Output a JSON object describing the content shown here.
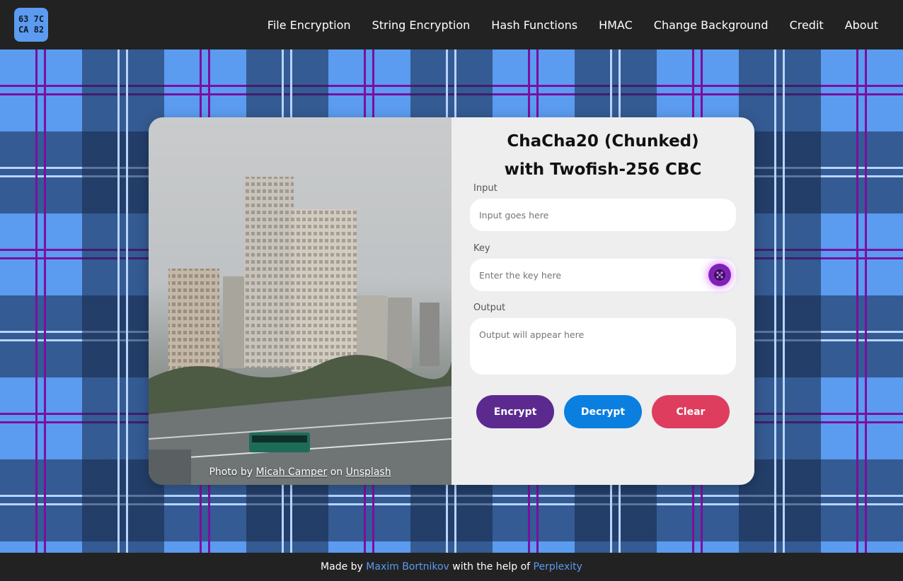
{
  "header": {
    "logo": {
      "line1": "63 7C",
      "line2": "CA 82"
    },
    "nav": [
      {
        "label": "File Encryption"
      },
      {
        "label": "String Encryption"
      },
      {
        "label": "Hash Functions"
      },
      {
        "label": "HMAC"
      },
      {
        "label": "Change Background"
      },
      {
        "label": "Credit"
      },
      {
        "label": "About"
      }
    ]
  },
  "card": {
    "photo_credit": {
      "prefix": "Photo by ",
      "author": "Micah Camper",
      "middle": " on ",
      "source": "Unsplash"
    },
    "title_line1": "ChaCha20 (Chunked)",
    "title_line2": "with Twofish-256 CBC",
    "input": {
      "label": "Input",
      "placeholder": "Input goes here"
    },
    "key": {
      "label": "Key",
      "placeholder": "Enter the key here",
      "button_icon": "dice-icon"
    },
    "output": {
      "label": "Output",
      "placeholder": "Output will appear here"
    },
    "buttons": {
      "encrypt": "Encrypt",
      "decrypt": "Decrypt",
      "clear": "Clear"
    }
  },
  "footer": {
    "prefix": "Made by ",
    "author": "Maxim Bortnikov",
    "middle": " with the help of ",
    "helper": "Perplexity"
  },
  "colors": {
    "accent": "#5b9bf0",
    "encrypt": "#5c2a8f",
    "decrypt": "#0a7fe0",
    "clear": "#de3d5d",
    "tartan_stripe": "#7a0fa0"
  }
}
